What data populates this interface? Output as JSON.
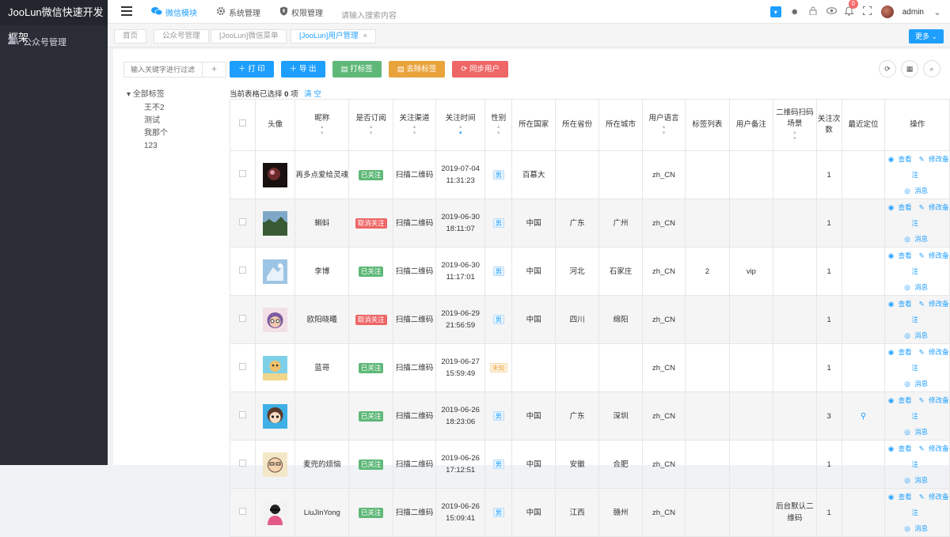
{
  "app": {
    "title": "JooLun微信快速开发框架"
  },
  "sidebar": {
    "items": [
      {
        "label": "公众号管理",
        "icon": "users-icon"
      }
    ]
  },
  "header": {
    "nav": [
      {
        "label": "微信模块",
        "icon": "wechat-icon",
        "active": true
      },
      {
        "label": "系统管理",
        "icon": "gear-icon",
        "active": false
      },
      {
        "label": "权限管理",
        "icon": "shield-icon",
        "active": false
      }
    ],
    "search_placeholder": "请输入搜索内容",
    "notification_count": "0",
    "user_name": "admin"
  },
  "tabs": [
    {
      "label": "首页",
      "active": false
    },
    {
      "label": "公众号管理",
      "active": false
    },
    {
      "label": "[JooLun]微信菜单",
      "active": false
    },
    {
      "label": "[JooLun]用户管理",
      "active": true
    }
  ],
  "more_label": "更多",
  "filter_placeholder": "输入关键字进行过滤",
  "tree": {
    "root": "全部标签",
    "children": [
      "王不2",
      "测试",
      "我那个",
      "123"
    ]
  },
  "toolbar": {
    "add": "打 印",
    "export": "导 出",
    "tag": "打标签",
    "untag": "去除标签",
    "sync": "同步用户"
  },
  "selection": {
    "prefix": "当前表格已选择",
    "count": "0",
    "suffix": "项",
    "clear": "清 空"
  },
  "columns": [
    "头像",
    "昵称",
    "是否订阅",
    "关注渠道",
    "关注时间",
    "性别",
    "所在国家",
    "所在省份",
    "所在城市",
    "用户语言",
    "标签列表",
    "用户备注",
    "二维码扫码场景",
    "关注次数",
    "最近定位",
    "操作"
  ],
  "ops": {
    "view": "查看",
    "edit_remark": "修改备注",
    "message": "消息"
  },
  "rows": [
    {
      "nickname": "再多点爱给灵魂",
      "subscribe": "已关注",
      "channel": "扫描二维码",
      "date": "2019-07-04",
      "time": "11:31:23",
      "sex": "男",
      "country": "百慕大",
      "province": "",
      "city": "",
      "lang": "zh_CN",
      "tags": "",
      "remark": "",
      "scene": "",
      "count": "1",
      "loc": ""
    },
    {
      "nickname": "蝌蚪",
      "subscribe": "取消关注",
      "channel": "扫描二维码",
      "date": "2019-06-30",
      "time": "18:11:07",
      "sex": "男",
      "country": "中国",
      "province": "广东",
      "city": "广州",
      "lang": "zh_CN",
      "tags": "",
      "remark": "",
      "scene": "",
      "count": "1",
      "loc": ""
    },
    {
      "nickname": "李博",
      "subscribe": "已关注",
      "channel": "扫描二维码",
      "date": "2019-06-30",
      "time": "11:17:01",
      "sex": "男",
      "country": "中国",
      "province": "河北",
      "city": "石家庄",
      "lang": "zh_CN",
      "tags": "2",
      "remark": "vip",
      "scene": "",
      "count": "1",
      "loc": ""
    },
    {
      "nickname": "欧阳晓曦",
      "subscribe": "取消关注",
      "channel": "扫描二维码",
      "date": "2019-06-29",
      "time": "21:56:59",
      "sex": "男",
      "country": "中国",
      "province": "四川",
      "city": "绵阳",
      "lang": "zh_CN",
      "tags": "",
      "remark": "",
      "scene": "",
      "count": "1",
      "loc": ""
    },
    {
      "nickname": "蓝哥",
      "subscribe": "已关注",
      "channel": "扫描二维码",
      "date": "2019-06-27",
      "time": "15:59:49",
      "sex": "未知",
      "country": "",
      "province": "",
      "city": "",
      "lang": "zh_CN",
      "tags": "",
      "remark": "",
      "scene": "",
      "count": "1",
      "loc": ""
    },
    {
      "nickname": "",
      "subscribe": "已关注",
      "channel": "扫描二维码",
      "date": "2019-06-26",
      "time": "18:23:06",
      "sex": "男",
      "country": "中国",
      "province": "广东",
      "city": "深圳",
      "lang": "zh_CN",
      "tags": "",
      "remark": "",
      "scene": "",
      "count": "3",
      "loc": "location-icon"
    },
    {
      "nickname": "麦兜的烦恼",
      "subscribe": "已关注",
      "channel": "扫描二维码",
      "date": "2019-06-26",
      "time": "17:12:51",
      "sex": "男",
      "country": "中国",
      "province": "安徽",
      "city": "合肥",
      "lang": "zh_CN",
      "tags": "",
      "remark": "",
      "scene": "",
      "count": "1",
      "loc": ""
    },
    {
      "nickname": "LiuJinYong",
      "subscribe": "已关注",
      "channel": "扫描二维码",
      "date": "2019-06-26",
      "time": "15:09:41",
      "sex": "男",
      "country": "中国",
      "province": "江西",
      "city": "赣州",
      "lang": "zh_CN",
      "tags": "",
      "remark": "",
      "scene": "后台默认二维码",
      "count": "1",
      "loc": ""
    }
  ]
}
